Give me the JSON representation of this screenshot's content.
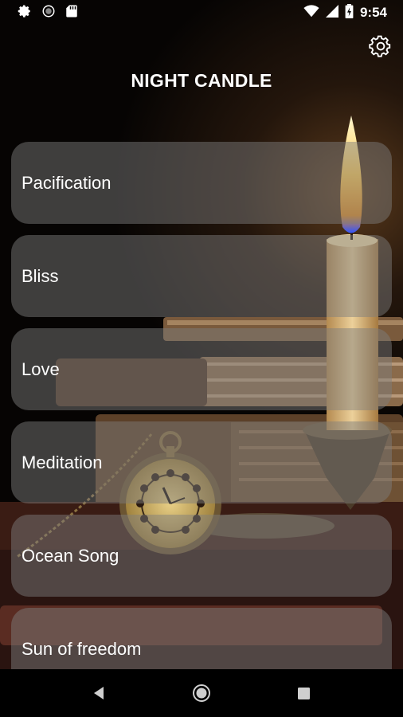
{
  "status_bar": {
    "time": "9:54"
  },
  "header": {
    "title": "NIGHT CANDLE",
    "settings_icon": "gear-icon"
  },
  "sounds": [
    {
      "label": "Pacification"
    },
    {
      "label": "Bliss"
    },
    {
      "label": "Love"
    },
    {
      "label": "Meditation"
    },
    {
      "label": "Ocean Song"
    },
    {
      "label": "Sun of freedom"
    }
  ],
  "nav": {
    "back_icon": "back-icon",
    "home_icon": "home-icon",
    "recents_icon": "recents-icon"
  },
  "colors": {
    "background": "#0a0705",
    "card": "#7d7d7d",
    "text": "#ffffff"
  }
}
